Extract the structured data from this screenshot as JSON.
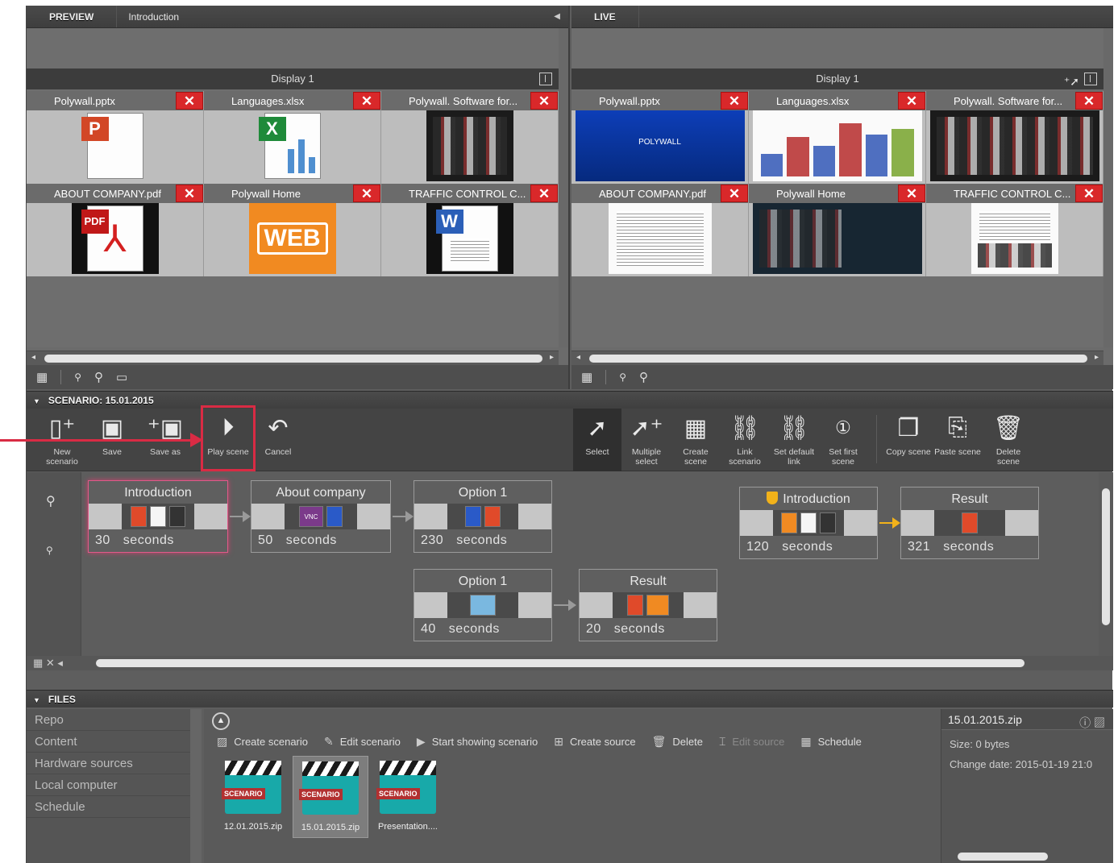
{
  "preview": {
    "tab": "PREVIEW",
    "breadcrumb": "Introduction",
    "display": "Display 1",
    "items": [
      {
        "name": "Polywall.pptx"
      },
      {
        "name": "Languages.xlsx"
      },
      {
        "name": "Polywall. Software for..."
      },
      {
        "name": "ABOUT COMPANY.pdf"
      },
      {
        "name": "Polywall Home"
      },
      {
        "name": "TRAFFIC CONTROL C..."
      }
    ],
    "web_badge": "WEB",
    "ppt_badge": "P",
    "xls_badge": "X",
    "doc_badge": "W",
    "pdf_badge": "PDF"
  },
  "live": {
    "tab": "LIVE",
    "display": "Display 1",
    "items": [
      {
        "name": "Polywall.pptx",
        "caption": "POLYWALL"
      },
      {
        "name": "Languages.xlsx"
      },
      {
        "name": "Polywall. Software for..."
      },
      {
        "name": "ABOUT COMPANY.pdf"
      },
      {
        "name": "Polywall Home"
      },
      {
        "name": "TRAFFIC CONTROL C..."
      }
    ]
  },
  "scenario": {
    "header": "SCENARIO: 15.01.2015",
    "tools": [
      {
        "label": "New scenario",
        "icon": "new-file-icon"
      },
      {
        "label": "Save",
        "icon": "floppy-icon"
      },
      {
        "label": "Save as",
        "icon": "floppy-plus-icon"
      },
      {
        "label": "Play scene",
        "icon": "play-icon"
      },
      {
        "label": "Cancel",
        "icon": "undo-icon"
      },
      {
        "label": "Select",
        "icon": "cursor-icon"
      },
      {
        "label": "Multiple select",
        "icon": "cursor-plus-icon"
      },
      {
        "label": "Create scene",
        "icon": "grid-plus-icon"
      },
      {
        "label": "Link scenario",
        "icon": "chain-icon"
      },
      {
        "label": "Set default link",
        "icon": "chain-arrow-icon"
      },
      {
        "label": "Set first scene",
        "icon": "number-one-icon"
      },
      {
        "label": "Copy scene",
        "icon": "copy-icon"
      },
      {
        "label": "Paste scene",
        "icon": "paste-icon"
      },
      {
        "label": "Delete scene",
        "icon": "trash-icon"
      }
    ],
    "seconds_label": "seconds",
    "scenes": [
      {
        "title": "Introduction",
        "duration": "30"
      },
      {
        "title": "About company",
        "duration": "50"
      },
      {
        "title": "Option 1",
        "duration": "230"
      },
      {
        "title": "Option 1",
        "duration": "40"
      },
      {
        "title": "Result",
        "duration": "20"
      },
      {
        "title": "Introduction",
        "duration": "120"
      },
      {
        "title": "Result",
        "duration": "321"
      }
    ],
    "vnc_badge": "VNC"
  },
  "files": {
    "header": "FILES",
    "nav": [
      "Repo",
      "Content",
      "Hardware sources",
      "Local computer",
      "Schedule"
    ],
    "toolbar": [
      {
        "label": "Create scenario",
        "enabled": true
      },
      {
        "label": "Edit scenario",
        "enabled": true
      },
      {
        "label": "Start showing scenario",
        "enabled": true
      },
      {
        "label": "Create source",
        "enabled": true
      },
      {
        "label": "Delete",
        "enabled": true
      },
      {
        "label": "Edit source",
        "enabled": false
      },
      {
        "label": "Schedule",
        "enabled": true
      }
    ],
    "items": [
      {
        "name": "12.01.2015.zip",
        "tag": "SCENARIO"
      },
      {
        "name": "15.01.2015.zip",
        "tag": "SCENARIO"
      },
      {
        "name": "Presentation....",
        "tag": "SCENARIO"
      }
    ],
    "info": {
      "title": "15.01.2015.zip",
      "size": "Size: 0 bytes",
      "change_date": "Change date: 2015-01-19 21:0"
    }
  },
  "colors": {
    "accent_red": "#d92b44",
    "close_red": "#d9282a",
    "link_yellow": "#f2b21a",
    "scenario_teal": "#18a9a9"
  }
}
